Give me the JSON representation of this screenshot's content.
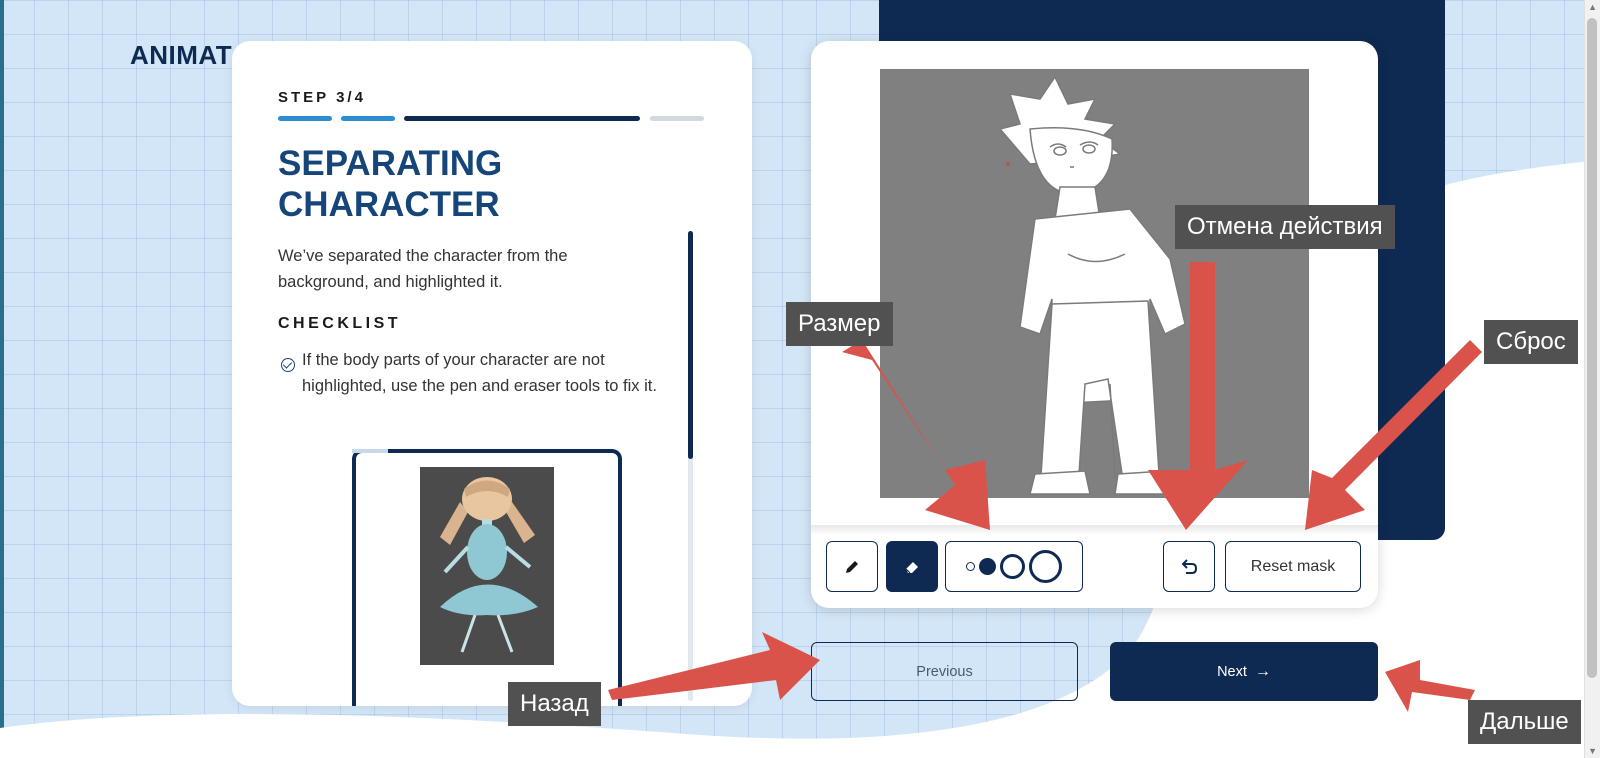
{
  "brand": {
    "title": "ANIMAT"
  },
  "step": {
    "label": "STEP 3/4",
    "progress_segments": 4,
    "current": 3
  },
  "content": {
    "title": "SEPARATING CHARACTER",
    "description": "We’ve separated the character from the background, and highlighted it.",
    "checklist_label": "CHECKLIST",
    "checklist_items": [
      "If the body parts of your character are not highlighted, use the pen and eraser tools to fix it."
    ]
  },
  "toolbar": {
    "pen_icon": "pencil-icon",
    "eraser_icon": "eraser-icon",
    "active_tool": "eraser",
    "sizes": [
      "small",
      "medium",
      "large",
      "xlarge"
    ],
    "selected_size": "medium",
    "undo_icon": "undo-icon",
    "reset_label": "Reset mask"
  },
  "navigation": {
    "previous_label": "Previous",
    "next_label": "Next",
    "next_icon": "arrow-right-icon"
  },
  "annotations": {
    "undo": "Отмена действия",
    "size": "Размер",
    "reset": "Сброс",
    "back": "Назад",
    "next": "Дальше"
  },
  "colors": {
    "navy": "#0f2a52",
    "title_blue": "#16457a",
    "progress_done": "#2c8ed0",
    "progress_todo": "#d3d9e0",
    "callout_bg": "#515151",
    "arrow_red": "#d9534a"
  }
}
